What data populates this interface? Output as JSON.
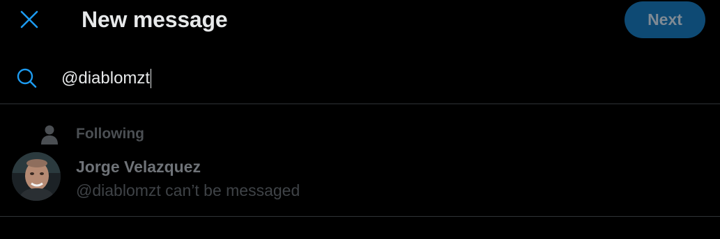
{
  "header": {
    "title": "New message",
    "next_label": "Next",
    "close_icon": "close-icon"
  },
  "search": {
    "value": "@diablomzt",
    "icon": "search-icon"
  },
  "results": [
    {
      "context_label": "Following",
      "context_icon": "person-icon",
      "name": "Jorge Velazquez",
      "status": "@diablomzt can’t be messaged"
    }
  ],
  "colors": {
    "accent": "#1d9bf0",
    "next_bg": "#0e4a74",
    "background": "#000000",
    "divider": "#2f3336"
  }
}
